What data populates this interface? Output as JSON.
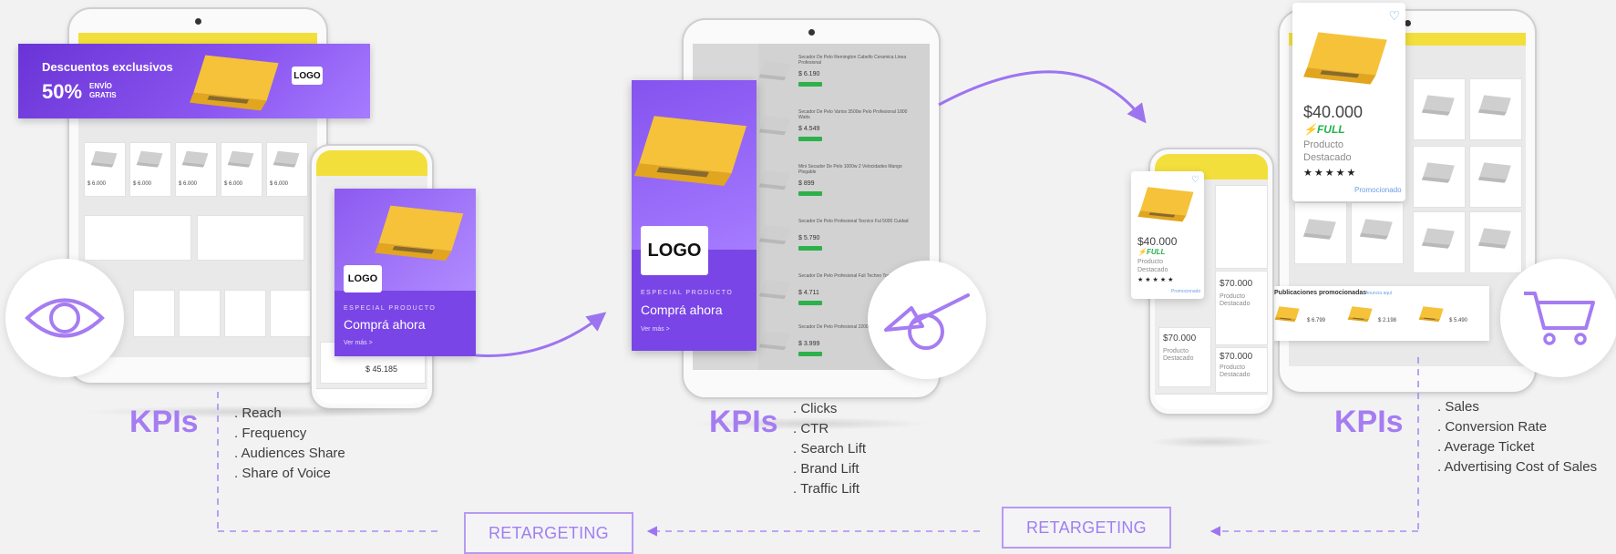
{
  "stage1": {
    "banner": {
      "title": "Descuentos exclusivos",
      "percent": "50%",
      "envio": "ENVÍO",
      "gratis": "GRATIS",
      "logo": "LOGO"
    },
    "ad": {
      "logo": "LOGO",
      "kicker": "ESPECIAL PRODUCTO",
      "cta": "Comprá ahora",
      "more": "Ver más >"
    },
    "phone_price": "$ 45.185",
    "tablet_prices": [
      "$ 6.000",
      "$ 6.000",
      "$ 6.000",
      "$ 6.000",
      "$ 6.000"
    ],
    "kpi": "KPIs",
    "metrics": [
      ". Reach",
      ". Frequency",
      ". Audiences Share",
      ". Share of Voice"
    ]
  },
  "stage2": {
    "ad": {
      "logo": "LOGO",
      "kicker": "ESPECIAL PRODUCTO",
      "cta": "Comprá ahora",
      "more": "Ver más >"
    },
    "list_items": [
      {
        "title": "Secador De Pelo Remington Cabello Ceramica Linea Profesional",
        "price": "$ 6.190"
      },
      {
        "title": "Secador De Pelo Varios 3500w Pelo Profesional 1800 Watts",
        "price": "$ 4.549"
      },
      {
        "title": "Mini Secador De Pelo 1000w 2 Velocidades Mango Plegable",
        "price": "$ 899"
      },
      {
        "title": "Secador De Pelo Profesional Tecnico Ful 5000 Cuidad",
        "price": "$ 5.790"
      },
      {
        "title": "Secador De Pelo Profesional Fuli Techno Tonalidades",
        "price": "$ 4.711"
      },
      {
        "title": "Secador De Pelo Profesional 2200w",
        "price": "$ 3.999"
      }
    ],
    "kpi": "KPIs",
    "metrics": [
      ". Clicks",
      ". CTR",
      ". Search Lift",
      ". Brand Lift",
      ". Traffic Lift"
    ]
  },
  "stage3": {
    "big_card": {
      "price": "$40.000",
      "full": "FULL",
      "line1": "Producto",
      "line2": "Destacado",
      "stars": "★★★★★",
      "promo": "Promocionado"
    },
    "small_card": {
      "price": "$40.000",
      "full": "FULL",
      "line1": "Producto",
      "line2": "Destacado",
      "stars": "★★★★★",
      "promo": "Promocionado"
    },
    "phone_cells": [
      {
        "price": "$70.000",
        "line1": "Producto",
        "line2": "Destacado"
      },
      {
        "price": "$70.000",
        "line1": "Producto",
        "line2": "Destacado"
      },
      {
        "price": "$70.000",
        "line1": "Producto",
        "line2": "Destacado"
      }
    ],
    "promo_strip": {
      "title": "Publicaciones promocionadas",
      "link": "Anuncia aquí",
      "prices": [
        "$ 6.799",
        "$ 2.198",
        "$ 5.490"
      ]
    },
    "kpi": "KPIs",
    "metrics": [
      ". Sales",
      ". Conversion Rate",
      ". Average Ticket",
      ". Advertising Cost of Sales"
    ]
  },
  "retargeting": [
    "RETARGETING",
    "RETARGETING"
  ],
  "colors": {
    "accent": "#a57cf2",
    "purple": "#7a45e6",
    "yellow": "#f3df3c",
    "laptop": "#f0b92a"
  },
  "icons": [
    "eye-icon",
    "cursor-click-icon",
    "shopping-cart-icon"
  ]
}
